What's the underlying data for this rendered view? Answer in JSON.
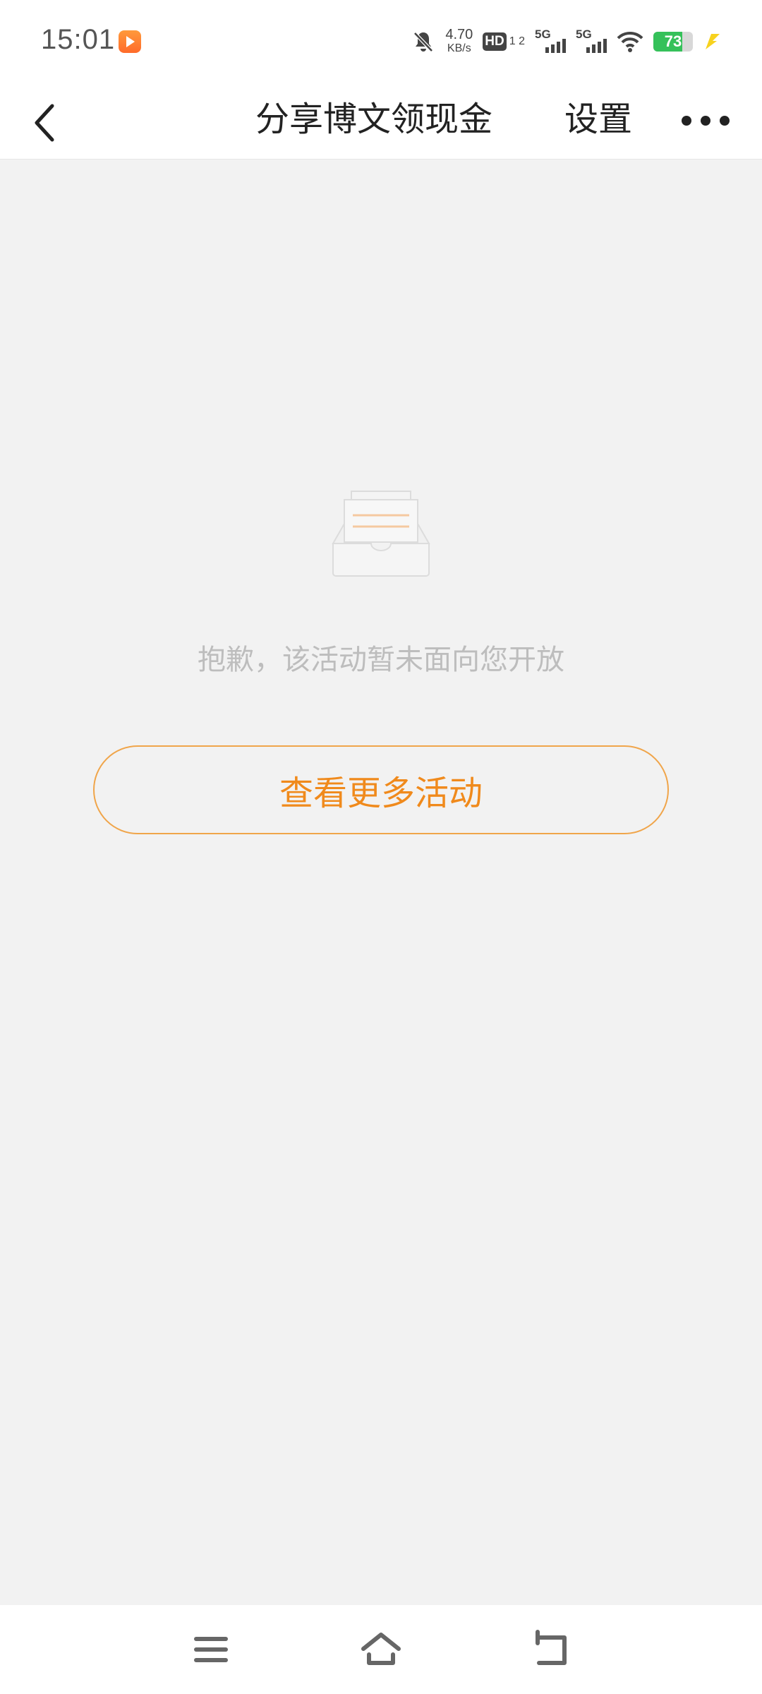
{
  "status_bar": {
    "time": "15:01",
    "net_speed_value": "4.70",
    "net_speed_unit": "KB/s",
    "hd_label": "HD",
    "hd_sub": "1 2",
    "sim1_tag": "5G",
    "sim2_tag": "5G",
    "battery_level": "73",
    "icons": [
      "app-notification-icon",
      "bell-mute-icon",
      "hd-icon",
      "signal-icon",
      "wifi-icon",
      "battery-icon",
      "charging-icon"
    ]
  },
  "nav": {
    "title": "分享博文领现金",
    "settings_label": "设置",
    "icons": [
      "back-icon",
      "more-icon"
    ]
  },
  "content": {
    "empty_message": "抱歉，该活动暂未面向您开放",
    "more_button_label": "查看更多活动",
    "accent_color": "#f08a1c",
    "icons": [
      "empty-inbox-icon"
    ]
  },
  "system_nav": {
    "icons": [
      "menu-icon",
      "home-icon",
      "back-gesture-icon"
    ]
  }
}
